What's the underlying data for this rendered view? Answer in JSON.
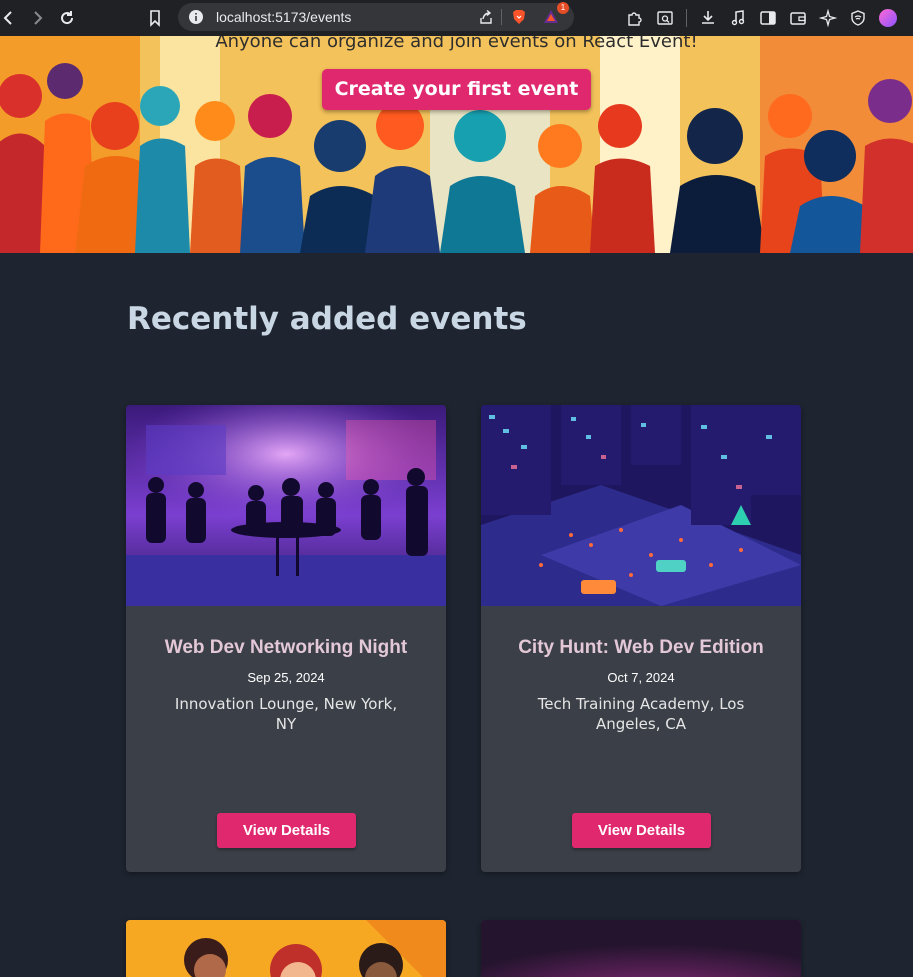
{
  "browser": {
    "url": "localhost:5173/events",
    "rewards_badge": "1"
  },
  "hero": {
    "subtitle": "Anyone can organize and join events on React Event!",
    "cta_label": "Create your first event"
  },
  "section": {
    "title": "Recently added events"
  },
  "events": [
    {
      "title": "Web Dev Networking Night",
      "date": "Sep 25, 2024",
      "location": "Innovation Lounge, New York, NY",
      "button": "View Details"
    },
    {
      "title": "City Hunt: Web Dev Edition",
      "date": "Oct 7, 2024",
      "location": "Tech Training Academy, Los Angeles, CA",
      "button": "View Details"
    }
  ],
  "colors": {
    "accent": "#e0286f",
    "page_bg": "#1f2530",
    "card_bg": "#3b3f47",
    "title_color": "#c9d6e3"
  }
}
